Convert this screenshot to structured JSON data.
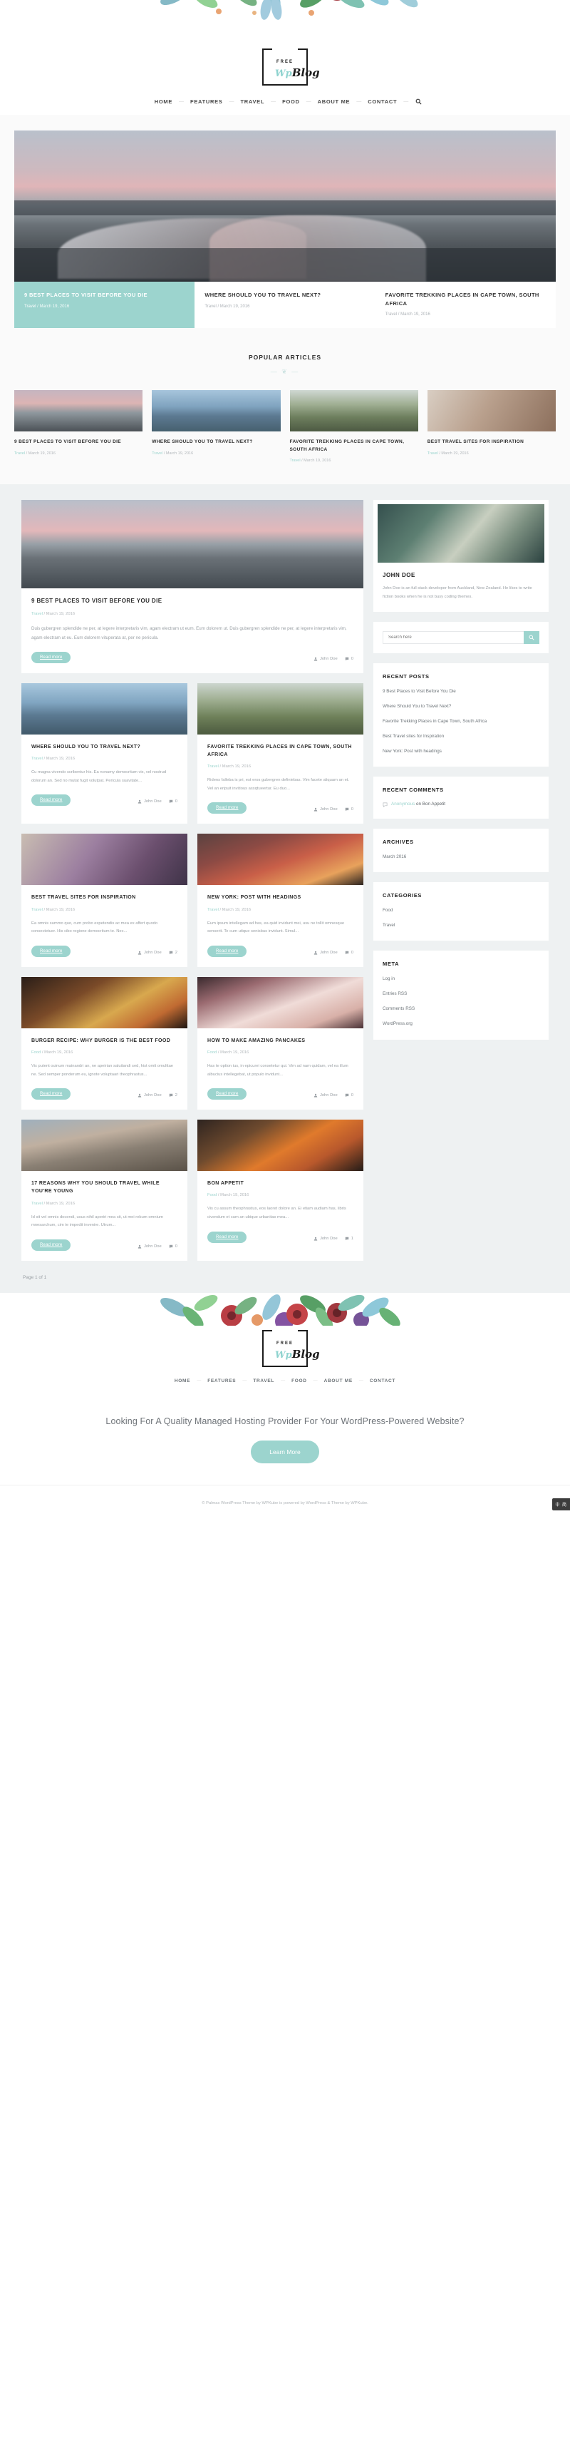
{
  "site": {
    "logo_top": "FREE",
    "logo_wp": "Wp",
    "logo_blog": "Blog"
  },
  "nav": {
    "items": [
      {
        "label": "HOME"
      },
      {
        "label": "FEATURES"
      },
      {
        "label": "TRAVEL"
      },
      {
        "label": "FOOD"
      },
      {
        "label": "ABOUT ME"
      },
      {
        "label": "CONTACT"
      }
    ],
    "separator": "—",
    "search_icon": "search-icon"
  },
  "slider": {
    "captions": [
      {
        "title": "9 BEST PLACES TO VISIT BEFORE YOU DIE",
        "cat": "Travel",
        "sep": "/",
        "date": "March 19, 2016",
        "active": true
      },
      {
        "title": "WHERE SHOULD YOU TO TRAVEL NEXT?",
        "cat": "Travel",
        "sep": "/",
        "date": "March 19, 2016",
        "active": false
      },
      {
        "title": "FAVORITE TREKKING PLACES IN CAPE TOWN, SOUTH AFRICA",
        "cat": "Travel",
        "sep": "/",
        "date": "March 19, 2016",
        "active": false
      }
    ]
  },
  "popular": {
    "title": "POPULAR ARTICLES",
    "ornament": "— ❦ —",
    "items": [
      {
        "title": "9 BEST PLACES TO VISIT BEFORE YOU DIE",
        "cat": "Travel",
        "sep": "/",
        "date": "March 19, 2016"
      },
      {
        "title": "WHERE SHOULD YOU TO TRAVEL NEXT?",
        "cat": "Travel",
        "sep": "/",
        "date": "March 19, 2016"
      },
      {
        "title": "FAVORITE TREKKING PLACES IN CAPE TOWN, SOUTH AFRICA",
        "cat": "Travel",
        "sep": "/",
        "date": "March 19, 2016"
      },
      {
        "title": "BEST TRAVEL SITES FOR INSPIRATION",
        "cat": "Travel",
        "sep": "/",
        "date": "March 19, 2016"
      }
    ]
  },
  "posts": {
    "read_more": "Read more",
    "featured": {
      "title": "9 BEST PLACES TO VISIT BEFORE YOU DIE",
      "cat": "Travel",
      "sep": "/",
      "date": "March 19, 2016",
      "excerpt": "Duis gubergren splendide ne per, at legere interpretaris vim, agam electram ut eum. Eum dolorem ut. Duis gubergren splendide ne per, at legere interpretaris vim, agam electram ut eu. Eum dolorem vituperata at, per ne pericula.",
      "author": "John Doe",
      "comments": "0"
    },
    "items": [
      {
        "title": "WHERE SHOULD YOU TO TRAVEL NEXT?",
        "cat": "Travel",
        "sep": "/",
        "date": "March 19, 2016",
        "excerpt": "Cu magna vivendo scribentur his. Ea nonumy democritum vix, vel nostrud dolorum an. Sed no mutat fugit volutpat. Pericula suavitate...",
        "author": "John Doe",
        "comments": "0"
      },
      {
        "title": "FAVORITE TREKKING PLACES IN CAPE TOWN, SOUTH AFRICA",
        "cat": "Travel",
        "sep": "/",
        "date": "March 19, 2016",
        "excerpt": "Ridens falleba is pri, est eros gubergren definiebas. Vim facete aliquam an et. Vel an eripuit invitious assqtueertur. Eu duo...",
        "author": "John Doe",
        "comments": "0"
      },
      {
        "title": "BEST TRAVEL SITES FOR INSPIRATION",
        "cat": "Travel",
        "sep": "/",
        "date": "March 19, 2016",
        "excerpt": "Ea omnis summo quo, cum probo expetendis ac mea ex affert quodo consectetuer. His cibo regione democritum te. Nec...",
        "author": "John Doe",
        "comments": "2"
      },
      {
        "title": "NEW YORK: POST WITH HEADINGS",
        "cat": "Travel",
        "sep": "/",
        "date": "March 19, 2016",
        "excerpt": "Eum ipsum intellegam ad has, ea quid invidunt mei, usu ne tollit omnesque senserit. Te cum utique senisbus invidunt. Simul...",
        "author": "John Doe",
        "comments": "0"
      },
      {
        "title": "BURGER RECIPE: WHY BURGER IS THE BEST FOOD",
        "cat": "Food",
        "sep": "/",
        "date": "March 19, 2016",
        "excerpt": "Vix putent ouinum mainandri an, ne apeirian saluitandi sed, hist omit omulttae ne. Sed semper ponderum eu, ignote voluptaari theophrastus...",
        "author": "John Doe",
        "comments": "2"
      },
      {
        "title": "HOW TO MAKE AMAZING PANCAKES",
        "cat": "Food",
        "sep": "/",
        "date": "March 19, 2016",
        "excerpt": "Has te option ius, in epicurei consetetur qui. Vim ad nam quidam, vel ea illum albucius intellegebat, ut populo invidunt...",
        "author": "John Doe",
        "comments": "0"
      },
      {
        "title": "17 REASONS WHY YOU SHOULD TRAVEL WHILE YOU'RE YOUNG",
        "cat": "Travel",
        "sep": "/",
        "date": "March 19, 2016",
        "excerpt": "Id sit vel omnis docendi, usus nihil aperiri mea sit, ut mei rebum omnium mnesarchum, cim te impedit invenire. Utrum...",
        "author": "John Doe",
        "comments": "0"
      },
      {
        "title": "BON APPETIT",
        "cat": "Food",
        "sep": "/",
        "date": "March 19, 2016",
        "excerpt": "Vis cu assum theophrastus, eos laoret dolore an. Ei etiam audiam has, libris civendum et cum an ubique urbanitas mea...",
        "author": "John Doe",
        "comments": "1"
      }
    ],
    "pagination": "Page 1 of 1"
  },
  "sidebar": {
    "author": {
      "name": "JOHN DOE",
      "bio": "John Doe is an full stack developer from Auckland, New Zealand. He likes to write fiction books when he is not busy coding themes."
    },
    "search": {
      "placeholder": "Search here",
      "icon": "search-icon"
    },
    "recent_posts": {
      "title": "RECENT POSTS",
      "items": [
        "9 Best Places to Visit Before You Die",
        "Where Should You to Travel Next?",
        "Favorite Trekking Places in Cape Town, South Africa",
        "Best Travel sites for Inspiration",
        "New York: Post with headings"
      ]
    },
    "recent_comments": {
      "title": "RECENT COMMENTS",
      "items": [
        {
          "who": "Anonymous",
          "on": "on",
          "post": "Bon Appetit"
        }
      ]
    },
    "archives": {
      "title": "ARCHIVES",
      "items": [
        "March 2016"
      ]
    },
    "categories": {
      "title": "CATEGORIES",
      "items": [
        "Food",
        "Travel"
      ]
    },
    "meta": {
      "title": "META",
      "items": [
        "Log in",
        "Entries RSS",
        "Comments RSS",
        "WordPress.org"
      ]
    }
  },
  "footer": {
    "nav": [
      {
        "label": "HOME"
      },
      {
        "label": "FEATURES"
      },
      {
        "label": "TRAVEL"
      },
      {
        "label": "FOOD"
      },
      {
        "label": "ABOUT ME"
      },
      {
        "label": "CONTACT"
      }
    ],
    "separator": "—",
    "cta_heading": "Looking For A Quality Managed Hosting Provider For Your WordPress-Powered Website?",
    "cta_button": "Learn More",
    "copyright": "© Palmas WordPress Theme by WPKube is powered by WordPress & Theme by WPKube.",
    "lang_badge": "中 简"
  },
  "colors": {
    "accent": "#9cd4ce",
    "body_bg": "#eef1f2",
    "text": "#545454"
  }
}
